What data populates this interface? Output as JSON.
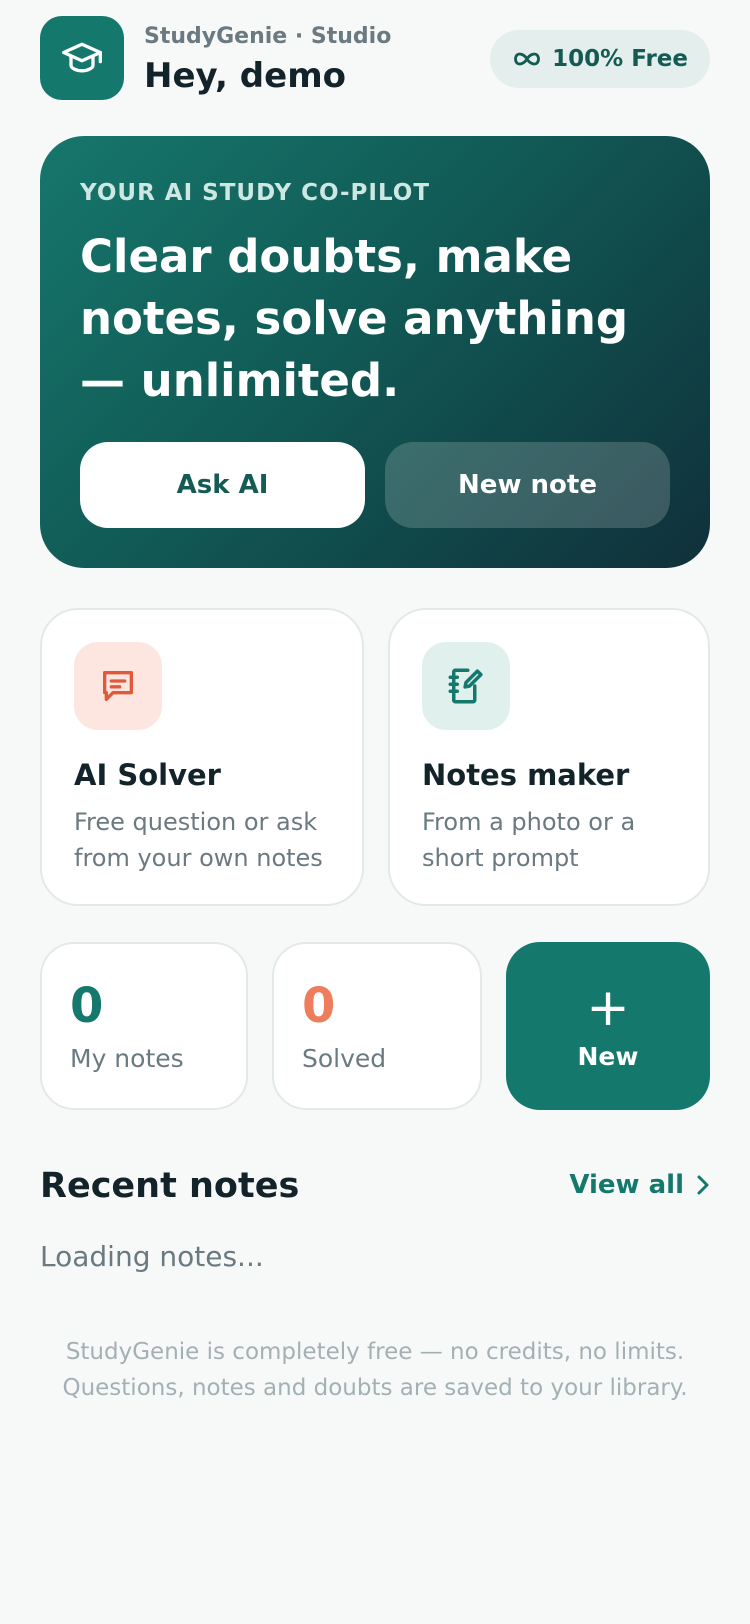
{
  "header": {
    "brand": "StudyGenie · Studio",
    "greeting": "Hey, demo",
    "badge_label": "100% Free",
    "logo_icon": "graduation-cap-icon",
    "badge_icon": "infinity-icon"
  },
  "hero": {
    "eyebrow": "YOUR AI STUDY CO-PILOT",
    "title": "Clear doubts, make notes, solve anything — unlimited.",
    "primary_button": "Ask AI",
    "secondary_button": "New note"
  },
  "features": [
    {
      "title": "AI Solver",
      "description": "Free question or ask from your own notes",
      "icon": "chat-icon"
    },
    {
      "title": "Notes maker",
      "description": "From a photo or a short prompt",
      "icon": "notebook-edit-icon"
    }
  ],
  "stats": [
    {
      "value": "0",
      "label": "My notes",
      "color": "#15786d"
    },
    {
      "value": "0",
      "label": "Solved",
      "color": "#ee7d5b"
    }
  ],
  "new_tile": {
    "symbol": "+",
    "label": "New"
  },
  "recent": {
    "title": "Recent notes",
    "view_all": "View all",
    "loading": "Loading notes..."
  },
  "footer": {
    "line1": "StudyGenie is completely free — no credits, no limits.",
    "line2": "Questions, notes and doubts are saved to your library."
  },
  "colors": {
    "accent": "#15786d",
    "orange": "#ee7d5b",
    "background": "#f7f9f9"
  }
}
